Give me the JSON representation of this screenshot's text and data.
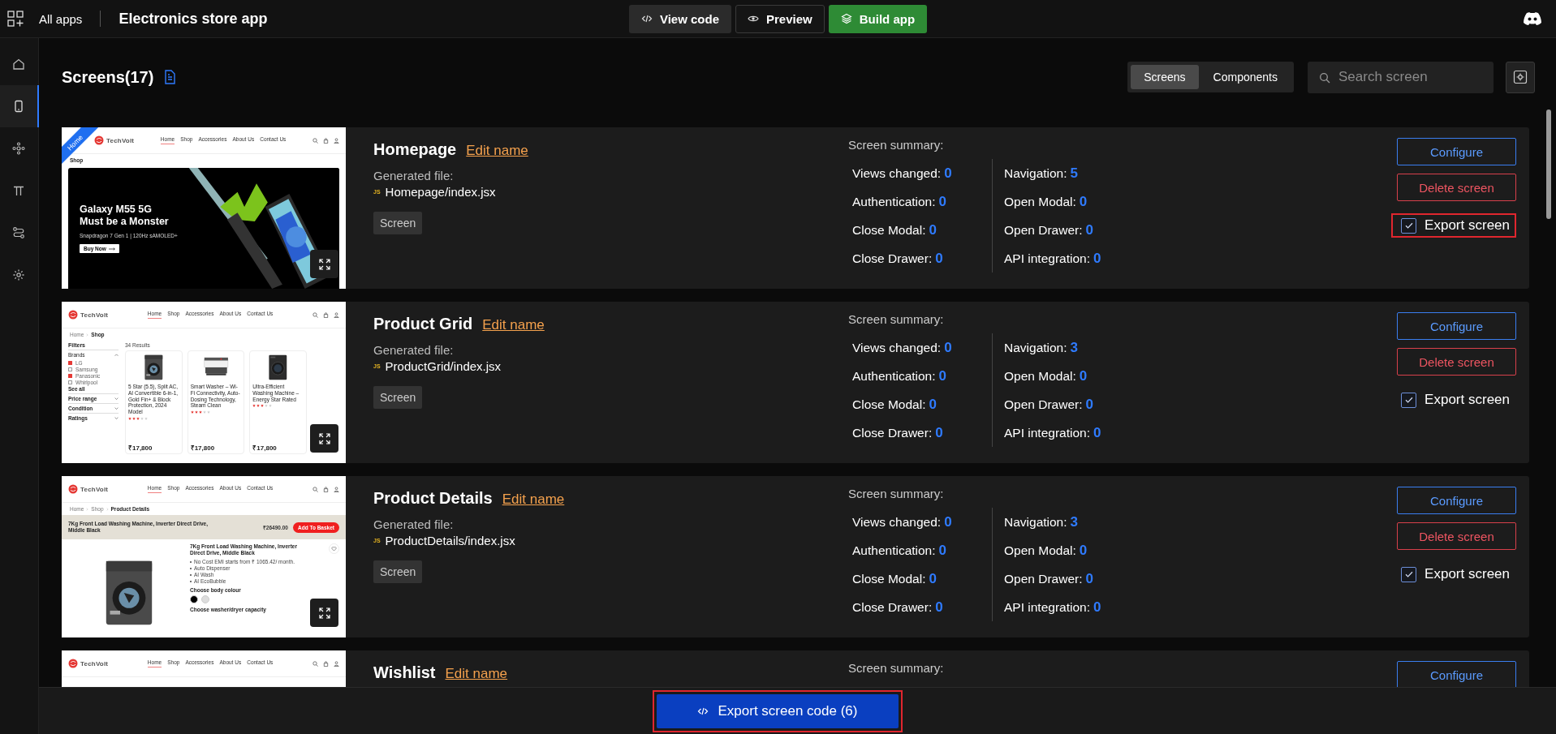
{
  "topbar": {
    "apps_label": "All apps",
    "title": "Electronics store app",
    "buttons": [
      {
        "kind": "code",
        "label": "View code"
      },
      {
        "kind": "preview",
        "label": "Preview"
      },
      {
        "kind": "build",
        "label": "Build app"
      }
    ]
  },
  "sidebar": {
    "items": [
      {
        "kind": "home",
        "selected": false
      },
      {
        "kind": "phone",
        "selected": true
      },
      {
        "kind": "nodes",
        "selected": false
      },
      {
        "kind": "pi",
        "selected": false
      },
      {
        "kind": "route",
        "selected": false
      },
      {
        "kind": "gear",
        "selected": false
      }
    ]
  },
  "header": {
    "title": "Screens(17)",
    "tabs": [
      {
        "label": "Screens",
        "selected": true
      },
      {
        "label": "Components",
        "selected": false
      }
    ],
    "search": {
      "placeholder": "Search screen"
    }
  },
  "screens": [
    {
      "name": "Homepage",
      "edit_label": "Edit name",
      "file_label": "Generated file:",
      "file_badge": "JS",
      "file": "Homepage/index.jsx",
      "tag": "Screen",
      "summary_title": "Screen summary:",
      "stat_columns": [
        {
          "items": [
            {
              "label": "Views changed:",
              "value": "0"
            },
            {
              "label": "Authentication:",
              "value": "0"
            },
            {
              "label": "Close Modal:",
              "value": "0"
            },
            {
              "label": "Close Drawer:",
              "value": "0"
            }
          ]
        },
        {
          "items": [
            {
              "label": "Navigation:",
              "value": "5"
            },
            {
              "label": "Open Modal:",
              "value": "0"
            },
            {
              "label": "Open Drawer:",
              "value": "0"
            },
            {
              "label": "API integration:",
              "value": "0"
            }
          ]
        }
      ],
      "configure": "Configure",
      "delete": "Delete screen",
      "export": {
        "label": "Export screen",
        "checked": true,
        "highlighted": true
      },
      "thumbnail": {
        "kind": "home",
        "ribbon": "Home",
        "brand": "TechVolt",
        "nav": [
          {
            "label": "Home",
            "selected": true
          },
          {
            "label": "Shop",
            "selected": false
          },
          {
            "label": "Accessories",
            "selected": false
          },
          {
            "label": "About Us",
            "selected": false
          },
          {
            "label": "Contact Us",
            "selected": false
          }
        ],
        "breadcrumb": [
          "Shop"
        ],
        "banner": {
          "title_lines": [
            "Galaxy M55 5G",
            "Must be a Monster"
          ],
          "subtitle": "Snapdragon 7 Gen 1 | 120Hz sAMOLED+",
          "cta": "Buy Now"
        },
        "expand_button": true
      }
    },
    {
      "name": "Product Grid",
      "edit_label": "Edit name",
      "file_label": "Generated file:",
      "file_badge": "JS",
      "file": "ProductGrid/index.jsx",
      "tag": "Screen",
      "summary_title": "Screen summary:",
      "stat_columns": [
        {
          "items": [
            {
              "label": "Views changed:",
              "value": "0"
            },
            {
              "label": "Authentication:",
              "value": "0"
            },
            {
              "label": "Close Modal:",
              "value": "0"
            },
            {
              "label": "Close Drawer:",
              "value": "0"
            }
          ]
        },
        {
          "items": [
            {
              "label": "Navigation:",
              "value": "3"
            },
            {
              "label": "Open Modal:",
              "value": "0"
            },
            {
              "label": "Open Drawer:",
              "value": "0"
            },
            {
              "label": "API integration:",
              "value": "0"
            }
          ]
        }
      ],
      "configure": "Configure",
      "delete": "Delete screen",
      "export": {
        "label": "Export screen",
        "checked": true,
        "highlighted": false
      },
      "thumbnail": {
        "kind": "grid",
        "brand": "TechVolt",
        "nav": [
          {
            "label": "Home",
            "selected": true
          },
          {
            "label": "Shop",
            "selected": false
          },
          {
            "label": "Accessories",
            "selected": false
          },
          {
            "label": "About Us",
            "selected": false
          },
          {
            "label": "Contact Us",
            "selected": false
          }
        ],
        "breadcrumb": [
          "Home",
          "Shop"
        ],
        "filters": {
          "title": "Filters",
          "group": "Brands",
          "options": [
            {
              "label": "LG",
              "checked": true
            },
            {
              "label": "Samsung",
              "checked": false
            },
            {
              "label": "Panasonic",
              "checked": true
            },
            {
              "label": "Whirlpool",
              "checked": false
            }
          ],
          "more": "See all",
          "sections": [
            "Price range",
            "Condition",
            "Ratings"
          ]
        },
        "results": "34 Results",
        "products": [
          {
            "kind": "front",
            "title": "5 Star (5.5), Split AC, AI Convertible 6-in-1, Gold Fin+ & Block Protection, 2024 Model",
            "stars": 3,
            "price": "₹17,800"
          },
          {
            "kind": "top",
            "title": "Smart Washer – Wi-Fi Connectivity, Auto-Dosing Technology, Steam Clean",
            "stars": 3,
            "price": "₹17,800"
          },
          {
            "kind": "dryer",
            "title": "Ultra-Efficient Washing Machine – Energy Star Rated",
            "stars": 3,
            "price": "₹17,800"
          }
        ],
        "expand_button": true
      }
    },
    {
      "name": "Product Details",
      "edit_label": "Edit name",
      "file_label": "Generated file:",
      "file_badge": "JS",
      "file": "ProductDetails/index.jsx",
      "tag": "Screen",
      "summary_title": "Screen summary:",
      "stat_columns": [
        {
          "items": [
            {
              "label": "Views changed:",
              "value": "0"
            },
            {
              "label": "Authentication:",
              "value": "0"
            },
            {
              "label": "Close Modal:",
              "value": "0"
            },
            {
              "label": "Close Drawer:",
              "value": "0"
            }
          ]
        },
        {
          "items": [
            {
              "label": "Navigation:",
              "value": "3"
            },
            {
              "label": "Open Modal:",
              "value": "0"
            },
            {
              "label": "Open Drawer:",
              "value": "0"
            },
            {
              "label": "API integration:",
              "value": "0"
            }
          ]
        }
      ],
      "configure": "Configure",
      "delete": "Delete screen",
      "export": {
        "label": "Export screen",
        "checked": true,
        "highlighted": false
      },
      "thumbnail": {
        "kind": "details",
        "brand": "TechVolt",
        "nav": [
          {
            "label": "Home",
            "selected": true
          },
          {
            "label": "Shop",
            "selected": false
          },
          {
            "label": "Accessories",
            "selected": false
          },
          {
            "label": "About Us",
            "selected": false
          },
          {
            "label": "Contact Us",
            "selected": false
          }
        ],
        "breadcrumb": [
          "Home",
          "Shop",
          "Product Details"
        ],
        "bar_title": "7Kg Front Load Washing Machine, Inverter Direct Drive, Middle Black",
        "price": "₹26490.00",
        "basket": "Add To Basket",
        "product_title": "7Kg Front Load Washing Machine, Inverter Direct Drive, Middle Black",
        "bullets": [
          "No Cost EMI starts from ₹ 1065.42/ month.",
          "Auto Dispenser",
          "AI Wash",
          "AI EcoBubble"
        ],
        "colour_heading": "Choose body colour",
        "swatches": [
          {
            "color": "#000000"
          },
          {
            "color": "#dddddd"
          }
        ],
        "capacity_heading": "Choose washer/dryer capacity",
        "expand_button": true
      }
    },
    {
      "name": "Wishlist",
      "edit_label": "Edit name",
      "summary_title": "Screen summary:",
      "configure": "Configure",
      "thumbnail": {
        "kind": "header",
        "brand": "TechVolt",
        "nav": [
          {
            "label": "Home",
            "selected": true
          },
          {
            "label": "Shop",
            "selected": false
          },
          {
            "label": "Accessories",
            "selected": false
          },
          {
            "label": "About Us",
            "selected": false
          },
          {
            "label": "Contact Us",
            "selected": false
          }
        ]
      }
    }
  ],
  "footer": {
    "button": "Export screen code (6)",
    "highlighted": true
  }
}
